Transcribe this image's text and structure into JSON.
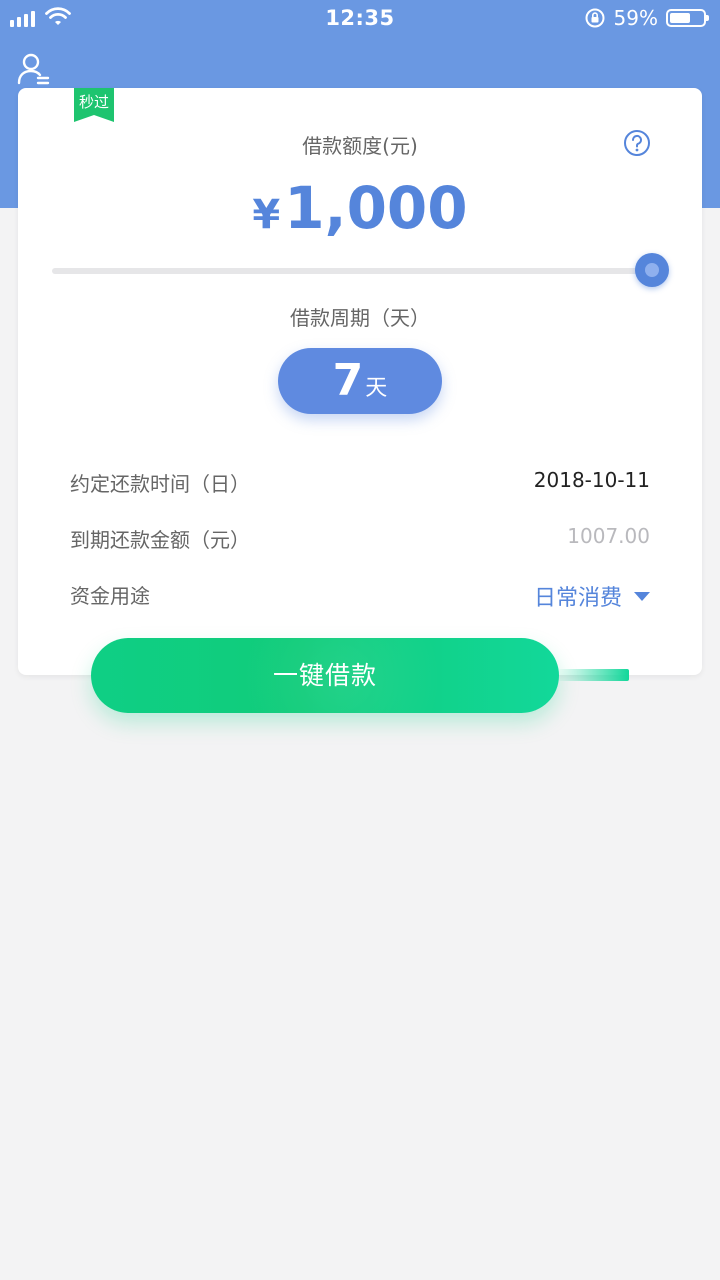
{
  "status_bar": {
    "time": "12:35",
    "battery": "59%",
    "icons": [
      "signal-icon",
      "wifi-icon",
      "orientation-lock-icon",
      "battery-icon"
    ]
  },
  "header": {
    "user_icon": "user-icon"
  },
  "card": {
    "badge": "秒过",
    "amount_label": "借款额度(元)",
    "currency": "¥",
    "amount": "1,000",
    "slider_level": 1.0,
    "period_label": "借款周期（天）",
    "period_value": "7",
    "period_unit": "天",
    "rows": [
      {
        "label": "约定还款时间（日）",
        "value": "2018-10-11"
      },
      {
        "label": "到期还款金额（元）",
        "value": "1007.00"
      },
      {
        "label": "资金用途",
        "value": "日常消费"
      }
    ]
  },
  "cta": {
    "label": "一键借款"
  },
  "colors": {
    "header": "#6a98e2",
    "accent": "#5585db",
    "button": "#10cc7a",
    "badge": "#1ec46f",
    "background": "#f3f3f4"
  }
}
